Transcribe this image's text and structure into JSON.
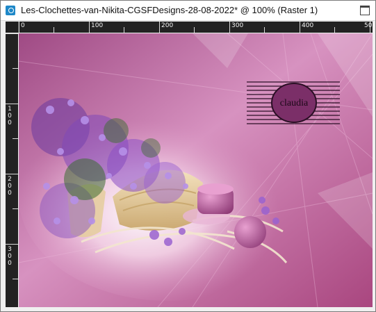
{
  "window": {
    "title": "Les-Clochettes-van-Nikita-CGSFDesigns-28-08-2022* @ 100% (Raster 1)",
    "app_icon": "image-document-icon",
    "maximize_icon": "maximize-icon"
  },
  "rulers": {
    "horizontal_labels": [
      "0",
      "100",
      "200",
      "300",
      "400",
      "50"
    ],
    "vertical_labels": [
      "1 0 0",
      "2 0 0",
      "3 0 0"
    ]
  },
  "canvas": {
    "watermark_text": "claudia",
    "colors": {
      "background": "#b65d95",
      "mauve_light": "#d792c0",
      "flower_purple": "#8a4fc4",
      "candle": "#c46aa8",
      "basket": "#e7cf9f"
    }
  }
}
